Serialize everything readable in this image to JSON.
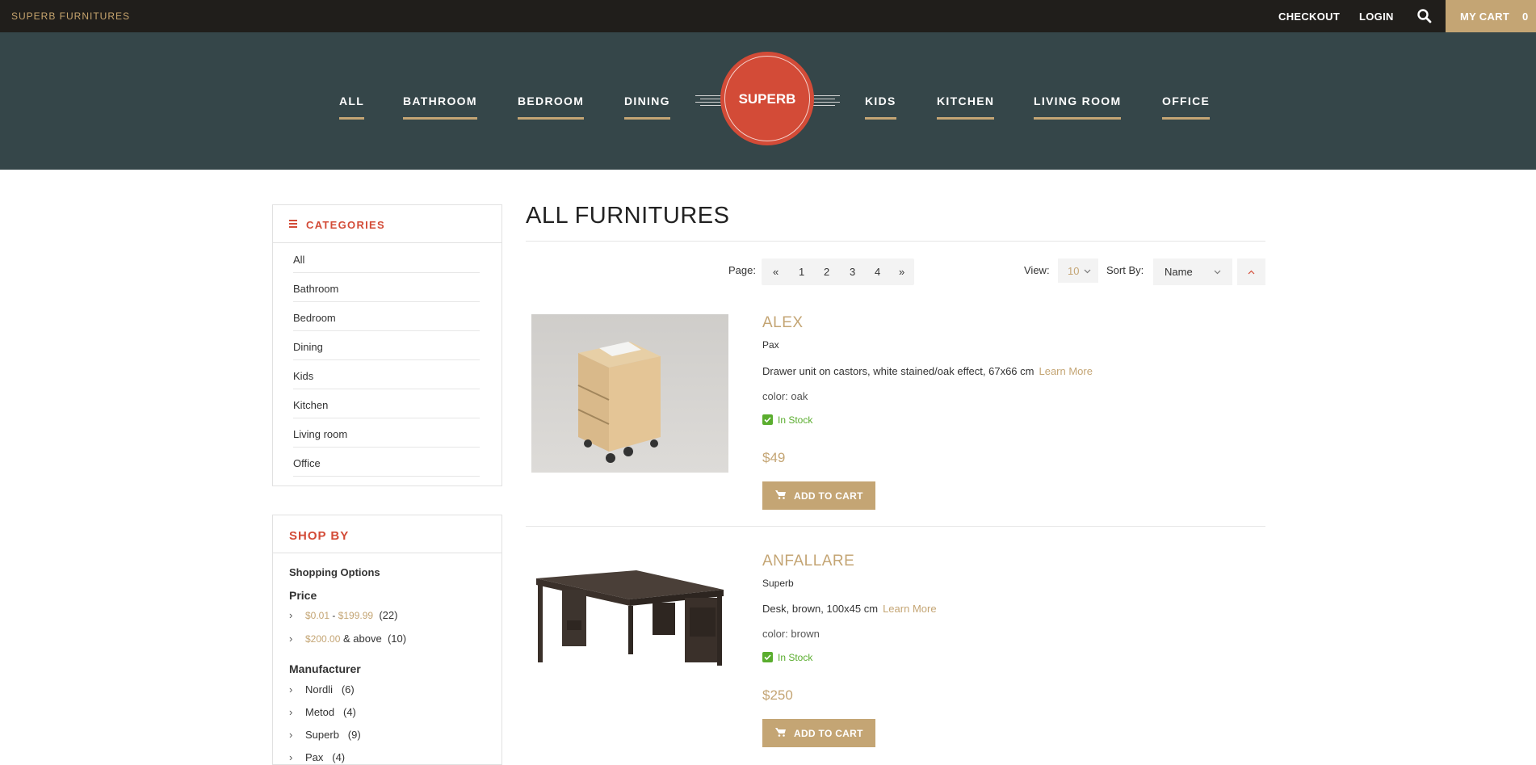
{
  "topbar": {
    "brand": "SUPERB FURNITURES",
    "checkout": "CHECKOUT",
    "login": "LOGIN",
    "cart_label": "MY CART",
    "cart_count": "0"
  },
  "nav": {
    "left": [
      "ALL",
      "BATHROOM",
      "BEDROOM",
      "DINING"
    ],
    "logo": "SUPERB",
    "right": [
      "KIDS",
      "KITCHEN",
      "LIVING ROOM",
      "OFFICE"
    ]
  },
  "categories": {
    "title": "CATEGORIES",
    "items": [
      "All",
      "Bathroom",
      "Bedroom",
      "Dining",
      "Kids",
      "Kitchen",
      "Living room",
      "Office"
    ]
  },
  "shop_by": {
    "title": "SHOP BY",
    "options_label": "Shopping Options",
    "price_label": "Price",
    "price1_low": "$0.01",
    "price1_sep": " - ",
    "price1_high": "$199.99",
    "price1_count": "(22)",
    "price2_low": "$200.00",
    "price2_suffix": " & above",
    "price2_count": "(10)",
    "manufacturer_label": "Manufacturer",
    "manufacturers": [
      {
        "name": "Nordli",
        "count": "(6)"
      },
      {
        "name": "Metod",
        "count": "(4)"
      },
      {
        "name": "Superb",
        "count": "(9)"
      },
      {
        "name": "Pax",
        "count": "(4)"
      }
    ]
  },
  "main": {
    "title": "ALL FURNITURES",
    "page_label": "Page:",
    "pages": [
      "«",
      "1",
      "2",
      "3",
      "4",
      "»"
    ],
    "view_label": "View:",
    "view_value": "10",
    "sort_label": "Sort By:",
    "sort_value": "Name"
  },
  "products": [
    {
      "name": "ALEX",
      "brand": "Pax",
      "description": "Drawer unit on castors, white stained/oak effect, 67x66 cm",
      "learn_more": "Learn More",
      "color": "color: oak",
      "stock": "In Stock",
      "price": "$49",
      "button": "ADD TO CART"
    },
    {
      "name": "ANFALLARE",
      "brand": "Superb",
      "description": "Desk, brown, 100x45 cm",
      "learn_more": "Learn More",
      "color": "color: brown",
      "stock": "In Stock",
      "price": "$250",
      "button": "ADD TO CART"
    }
  ],
  "colors": {
    "topbar_bg": "#201e1b",
    "nav_bg": "#354649",
    "accent_gold": "#c4a574",
    "accent_red": "#d34b37",
    "in_stock_green": "#5aad2e"
  }
}
